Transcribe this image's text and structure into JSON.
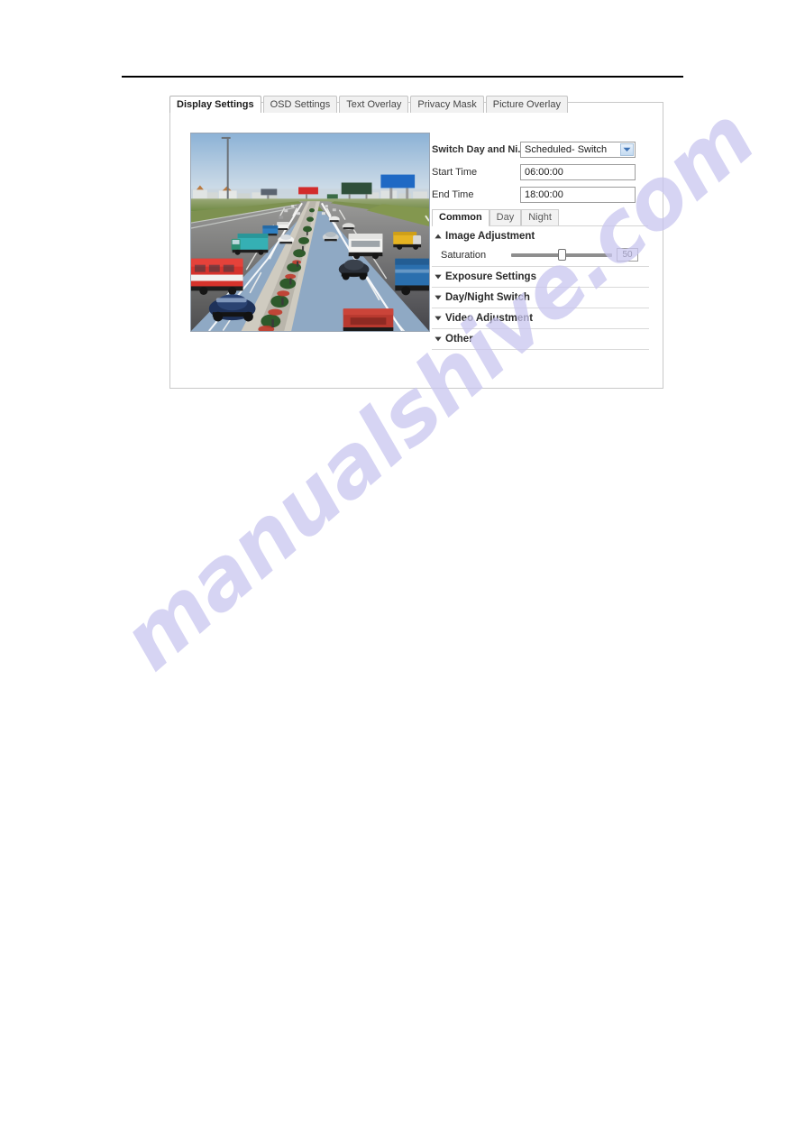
{
  "page": {
    "watermark_text": "manualshive.com",
    "watermark_color": "#c9c6ef"
  },
  "panel": {
    "tabs": [
      {
        "label": "Display Settings",
        "active": true
      },
      {
        "label": "OSD Settings",
        "active": false
      },
      {
        "label": "Text Overlay",
        "active": false
      },
      {
        "label": "Privacy Mask",
        "active": false
      },
      {
        "label": "Picture Overlay",
        "active": false
      }
    ],
    "preview": {
      "alt": "live-video-highway-traffic-scene"
    },
    "fields": {
      "switch_day_night_label": "Switch Day and Ni...",
      "switch_day_night_value": "Scheduled- Switch",
      "start_time_label": "Start Time",
      "start_time_value": "06:00:00",
      "end_time_label": "End Time",
      "end_time_value": "18:00:00"
    },
    "subtabs": [
      {
        "label": "Common",
        "active": true
      },
      {
        "label": "Day",
        "active": false
      },
      {
        "label": "Night",
        "active": false
      }
    ],
    "accordion": [
      {
        "title": "Image Adjustment",
        "expanded": true,
        "caret": "caret-up-icon",
        "slider": {
          "label": "Saturation",
          "value": "50",
          "percent": 50
        }
      },
      {
        "title": "Exposure Settings",
        "expanded": false,
        "caret": "caret-down-icon"
      },
      {
        "title": "Day/Night Switch",
        "expanded": false,
        "caret": "caret-down-icon"
      },
      {
        "title": "Video Adjustment",
        "expanded": false,
        "caret": "caret-down-icon"
      },
      {
        "title": "Other",
        "expanded": false,
        "caret": "caret-down-icon"
      }
    ]
  },
  "colors": {
    "accent_blue": "#3f73b5",
    "panel_border": "#c8c8c8",
    "divider": "#d9d9d9"
  }
}
